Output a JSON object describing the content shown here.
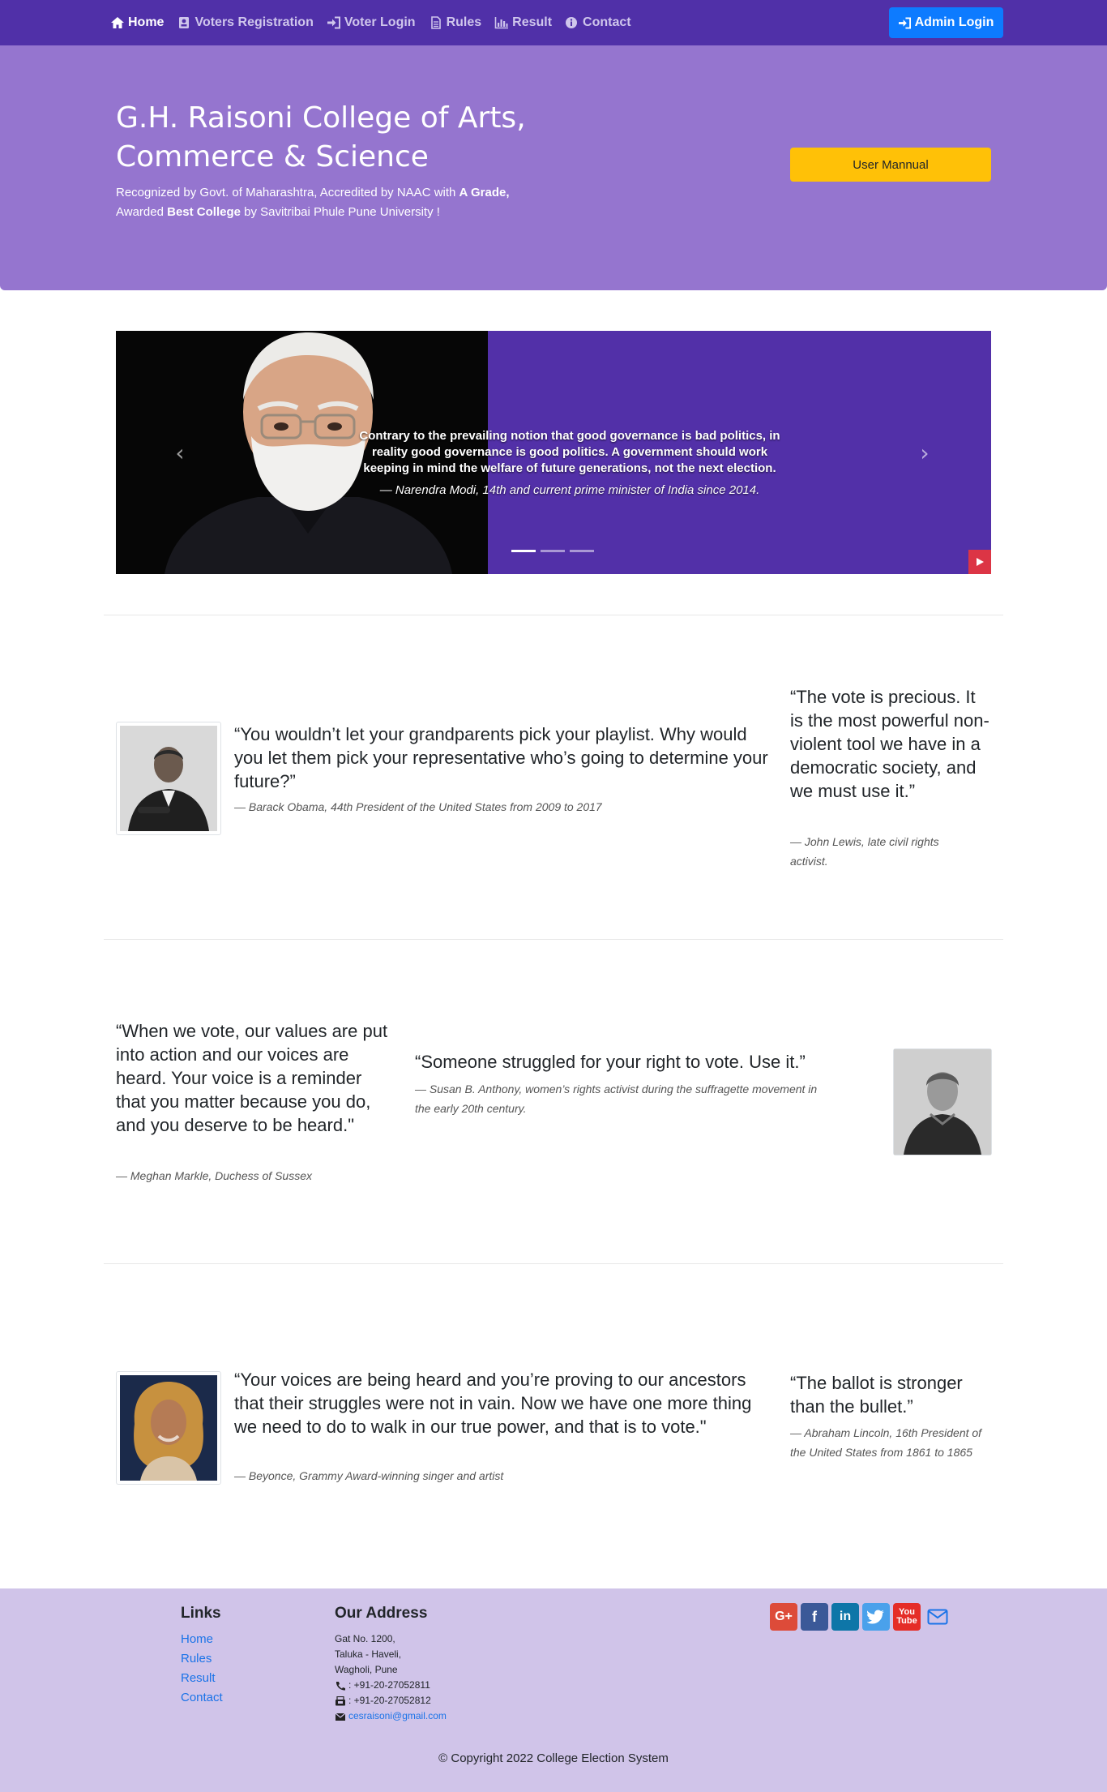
{
  "nav": {
    "items": [
      {
        "label": "Home",
        "icon": "home-icon"
      },
      {
        "label": "Voters Registration",
        "icon": "id-card-icon"
      },
      {
        "label": "Voter Login",
        "icon": "sign-in-icon"
      },
      {
        "label": "Rules",
        "icon": "file-icon"
      },
      {
        "label": "Result",
        "icon": "bar-chart-icon"
      },
      {
        "label": "Contact",
        "icon": "info-circle-icon"
      }
    ],
    "admin_login": "Admin Login"
  },
  "hero": {
    "title": "G.H. Raisoni College of Arts, Commerce & Science",
    "sub_1": "Recognized by Govt. of Maharashtra, Accredited by NAAC with ",
    "sub_1_bold": "A Grade,",
    "sub_2": "Awarded ",
    "sub_2_bold": "Best College",
    "sub_3": " by Savitribai Phule Pune University !",
    "manual_button": "User Mannual"
  },
  "carousel": {
    "quote": "Contrary to the prevailing notion that good governance is bad politics, in reality good governance is good politics. A government should work keeping in mind the welfare of future generations, not the next election.",
    "cite": "— Narendra Modi, 14th and current prime minister of India since 2014.",
    "prev": "‹",
    "next": "›",
    "indicator_count": 3,
    "active_indicator": 1
  },
  "quotes": {
    "obama": {
      "text": "“You wouldn’t let your grandparents pick your playlist. Why would you let them pick your representative who’s going to determine your future?”",
      "cite": "— Barack Obama, 44th President of the United States from 2009 to 2017"
    },
    "lewis": {
      "text": "“The vote is precious. It is the most powerful non-violent tool we have in a democratic society, and we must use it.”",
      "cite": "— John Lewis, late civil rights activist."
    },
    "markle": {
      "text": "“When we vote, our values are put into action and our voices are heard. Your voice is a reminder that you matter because you do, and you deserve to be heard.\"",
      "cite": "— Meghan Markle, Duchess of Sussex"
    },
    "anthony": {
      "text": "“Someone struggled for your right to vote. Use it.”",
      "cite": "— Susan B. Anthony, women’s rights activist during the suffragette movement in the early 20th century."
    },
    "beyonce": {
      "text": "“Your voices are being heard and you’re proving to our ancestors that their struggles were not in vain. Now we have one more thing we need to do to walk in our true power, and that is to vote.\"",
      "cite": "— Beyonce, Grammy Award-winning singer and artist"
    },
    "lincoln": {
      "text": "“The ballot is stronger than the bullet.”",
      "cite": "— Abraham Lincoln, 16th President of the United States from 1861 to 1865"
    }
  },
  "footer": {
    "links_heading": "Links",
    "links": [
      "Home",
      "Rules",
      "Result",
      "Contact"
    ],
    "address_heading": "Our Address",
    "address_lines": [
      "Gat No. 1200,",
      "Taluka - Haveli,",
      "Wagholi, Pune"
    ],
    "phone": ": +91-20-27052811",
    "fax": ": +91-20-27052812",
    "email": "cesraisoni@gmail.com",
    "socials": [
      "google-plus-icon",
      "facebook-icon",
      "linkedin-icon",
      "twitter-icon",
      "youtube-icon",
      "envelope-icon"
    ],
    "copyright": "© Copyright 2022 College Election System"
  },
  "colors": {
    "navbar": "#5030a8",
    "hero": "#9575cf",
    "accent_yellow": "#ffc107",
    "admin_blue": "#0d7bff",
    "footer": "#d0c4e9"
  }
}
